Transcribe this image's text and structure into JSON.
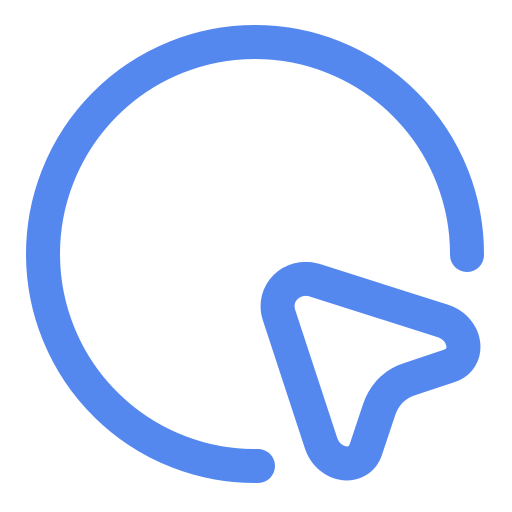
{
  "icon": {
    "name": "cursor-click-icon",
    "stroke_color": "#5588EE"
  }
}
